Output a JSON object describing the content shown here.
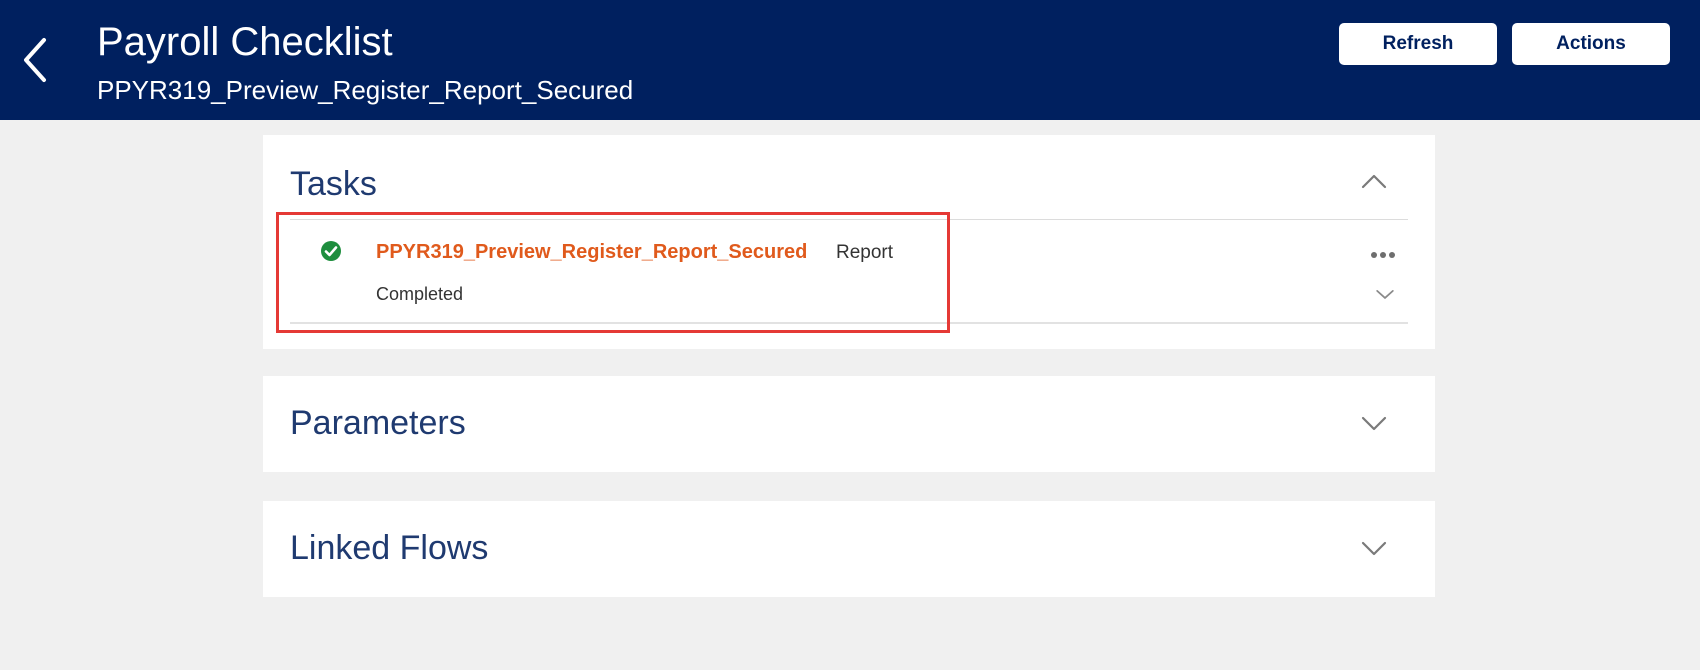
{
  "header": {
    "title": "Payroll Checklist",
    "subtitle": "PPYR319_Preview_Register_Report_Secured",
    "refresh_label": "Refresh",
    "actions_label": "Actions",
    "back_icon": "back-arrow-icon",
    "background_color": "#00205f"
  },
  "tasks_panel": {
    "title": "Tasks",
    "expanded": true,
    "items": [
      {
        "status_icon": "check-circle-icon",
        "status_icon_color": "#1e8e3e",
        "name": "PPYR319_Preview_Register_Report_Secured",
        "type": "Report",
        "status": "Completed",
        "name_color": "#e05a1c"
      }
    ]
  },
  "parameters_panel": {
    "title": "Parameters",
    "expanded": false
  },
  "linked_flows_panel": {
    "title": "Linked Flows",
    "expanded": false
  },
  "highlight_color": "#e53935"
}
